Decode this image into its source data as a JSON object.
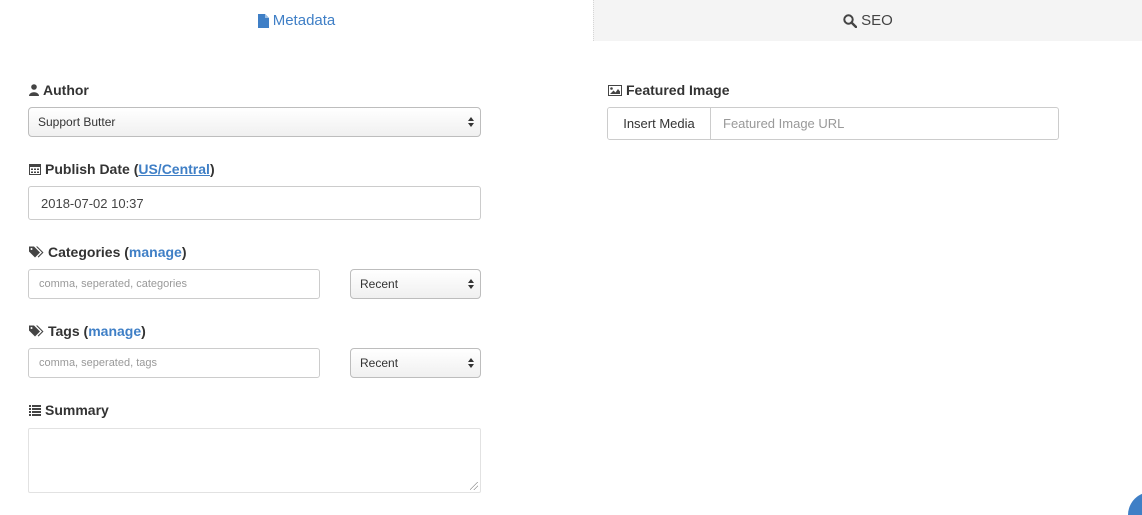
{
  "tabs": {
    "metadata": {
      "label": "Metadata",
      "icon": "file-icon",
      "active": true
    },
    "seo": {
      "label": "SEO",
      "icon": "search-icon",
      "active": false
    }
  },
  "author": {
    "label": "Author",
    "icon": "user-icon",
    "selected": "Support Butter"
  },
  "publish_date": {
    "label": "Publish Date",
    "timezone_open": "(",
    "timezone": "US/Central",
    "timezone_close": ")",
    "icon": "calendar-icon",
    "value": "2018-07-02 10:37"
  },
  "categories": {
    "label": "Categories",
    "manage_open": "(",
    "manage": "manage",
    "manage_close": ")",
    "icon": "tags-icon",
    "placeholder": "comma, seperated, categories",
    "filter": "Recent"
  },
  "tags": {
    "label": "Tags",
    "manage_open": "(",
    "manage": "manage",
    "manage_close": ")",
    "icon": "tags-icon",
    "placeholder": "comma, seperated, tags",
    "filter": "Recent"
  },
  "summary": {
    "label": "Summary",
    "icon": "list-icon",
    "value": ""
  },
  "featured_image": {
    "label": "Featured Image",
    "icon": "image-icon",
    "button": "Insert Media",
    "placeholder": "Featured Image URL"
  },
  "colors": {
    "accent": "#3f7fc6",
    "inactive_tab": "#f4f4f4"
  }
}
